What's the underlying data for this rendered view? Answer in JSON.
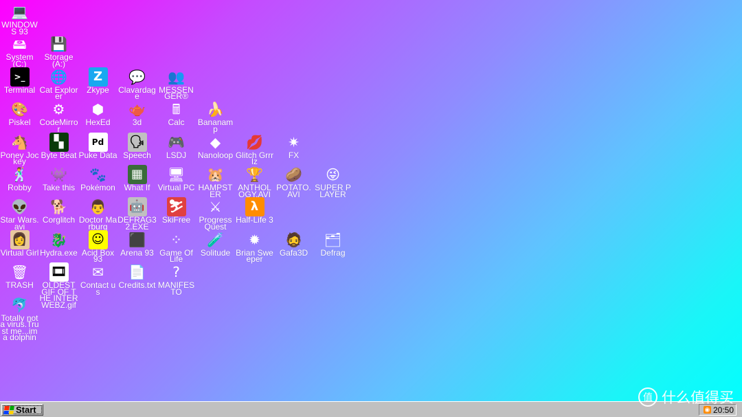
{
  "desktop": {
    "icons": [
      {
        "label": "WINDOWS 93",
        "icon": "computer-icon",
        "glyph": "💻",
        "bg": "transparent"
      },
      {
        "label": "System (C:)",
        "icon": "hard-drive-icon",
        "glyph": "🖴",
        "bg": "transparent"
      },
      {
        "label": "Storage (A:)",
        "icon": "floppy-drive-icon",
        "glyph": "💾",
        "bg": "transparent"
      },
      {
        "label": "Terminal",
        "icon": "terminal-icon",
        "glyph": ">_",
        "bg": "#000000"
      },
      {
        "label": "Cat Explorer",
        "icon": "globe-cat-icon",
        "glyph": "🌐",
        "bg": "transparent"
      },
      {
        "label": "Zkype",
        "icon": "zkype-icon",
        "glyph": "Z",
        "bg": "#18a8f0"
      },
      {
        "label": "Clavardage",
        "icon": "chat-bubble-icon",
        "glyph": "💬",
        "bg": "transparent"
      },
      {
        "label": "MESSENGER®",
        "icon": "messenger-icon",
        "glyph": "👥",
        "bg": "transparent"
      },
      {
        "label": "Piskel",
        "icon": "palette-icon",
        "glyph": "🎨",
        "bg": "transparent"
      },
      {
        "label": "CodeMirror",
        "icon": "codemirror-icon",
        "glyph": "⚙",
        "bg": "transparent"
      },
      {
        "label": "HexEd",
        "icon": "hex-cube-icon",
        "glyph": "⬢",
        "bg": "transparent"
      },
      {
        "label": "3d",
        "icon": "teapot-icon",
        "glyph": "🫖",
        "bg": "transparent"
      },
      {
        "label": "Calc",
        "icon": "calculator-icon",
        "glyph": "🖩",
        "bg": "transparent"
      },
      {
        "label": "Bananamp",
        "icon": "banana-icon",
        "glyph": "🍌",
        "bg": "transparent"
      },
      {
        "label": "Poney Jockey",
        "icon": "pony-icon",
        "glyph": "🐴",
        "bg": "transparent"
      },
      {
        "label": "Byte Beat",
        "icon": "bytebeat-icon",
        "glyph": "▚",
        "bg": "#0a3a0a"
      },
      {
        "label": "Puke Data",
        "icon": "puke-data-icon",
        "glyph": "Pd",
        "bg": "#ffffff"
      },
      {
        "label": "Speech",
        "icon": "speech-face-icon",
        "glyph": "🗣",
        "bg": "#c0c0c0"
      },
      {
        "label": "LSDJ",
        "icon": "gameboy-icon",
        "glyph": "🎮",
        "bg": "transparent"
      },
      {
        "label": "Nanoloop",
        "icon": "nanoloop-icon",
        "glyph": "◆",
        "bg": "transparent"
      },
      {
        "label": "Glitch Grrrlz",
        "icon": "lips-icon",
        "glyph": "💋",
        "bg": "transparent"
      },
      {
        "label": "FX",
        "icon": "fx-star-icon",
        "glyph": "✷",
        "bg": "transparent"
      },
      {
        "label": "Robby",
        "icon": "stick-figure-icon",
        "glyph": "🕺",
        "bg": "transparent"
      },
      {
        "label": "Take this",
        "icon": "take-this-icon",
        "glyph": "👾",
        "bg": "transparent"
      },
      {
        "label": "Pokémon",
        "icon": "pokemon-icon",
        "glyph": "🐾",
        "bg": "transparent"
      },
      {
        "label": "What If",
        "icon": "what-if-icon",
        "glyph": "▦",
        "bg": "#3a6b3a"
      },
      {
        "label": "Virtual PC",
        "icon": "virtual-pc-icon",
        "glyph": "🖥",
        "bg": "transparent"
      },
      {
        "label": "HAMPSTER",
        "icon": "hampster-icon",
        "glyph": "🐹",
        "bg": "transparent"
      },
      {
        "label": "ANTHOLOGY.AVI",
        "icon": "trophy-icon",
        "glyph": "🏆",
        "bg": "transparent"
      },
      {
        "label": "POTATO.AVI",
        "icon": "potato-icon",
        "glyph": "🥔",
        "bg": "transparent"
      },
      {
        "label": "SUPER PLAYER",
        "icon": "troll-face-icon",
        "glyph": "😜",
        "bg": "transparent"
      },
      {
        "label": "Star Wars.avi",
        "icon": "yoda-icon",
        "glyph": "👽",
        "bg": "transparent"
      },
      {
        "label": "Corglitch",
        "icon": "corgi-icon",
        "glyph": "🐕",
        "bg": "transparent"
      },
      {
        "label": "Doctor Marburg",
        "icon": "doctor-icon",
        "glyph": "👨",
        "bg": "transparent"
      },
      {
        "label": "DEFRAG32.EXE",
        "icon": "defrag32-icon",
        "glyph": "🤖",
        "bg": "#c0c0c0"
      },
      {
        "label": "SkiFree",
        "icon": "skifree-icon",
        "glyph": "⛷",
        "bg": "#e04040"
      },
      {
        "label": "Progress Quest",
        "icon": "crossed-swords-icon",
        "glyph": "⚔",
        "bg": "transparent"
      },
      {
        "label": "Half-Life 3",
        "icon": "half-life-icon",
        "glyph": "λ",
        "bg": "#ff8c00"
      },
      {
        "label": "Virtual Girl",
        "icon": "virtual-girl-icon",
        "glyph": "👩",
        "bg": "#e8c8a0"
      },
      {
        "label": "Hydra.exe",
        "icon": "hydra-icon",
        "glyph": "🐉",
        "bg": "transparent"
      },
      {
        "label": "Acid Box 93",
        "icon": "acid-smiley-icon",
        "glyph": "☺",
        "bg": "#ffff00"
      },
      {
        "label": "Arena 93",
        "icon": "arena-cube-icon",
        "glyph": "⬛",
        "bg": "transparent"
      },
      {
        "label": "Game Of Life",
        "icon": "game-of-life-icon",
        "glyph": "⁘",
        "bg": "transparent"
      },
      {
        "label": "Solitude",
        "icon": "solitude-icon",
        "glyph": "🧪",
        "bg": "transparent"
      },
      {
        "label": "Brian Sweeper",
        "icon": "mine-icon",
        "glyph": "✹",
        "bg": "transparent"
      },
      {
        "label": "Gafa3D",
        "icon": "gafa3d-icon",
        "glyph": "🧔",
        "bg": "transparent"
      },
      {
        "label": "Defrag",
        "icon": "defrag-icon",
        "glyph": "🗂",
        "bg": "transparent"
      },
      {
        "label": "TRASH",
        "icon": "trash-icon",
        "glyph": "🗑",
        "bg": "transparent"
      },
      {
        "label": "OLDEST GIF OF THE INTERWEBZ.gif",
        "icon": "gif-file-icon",
        "glyph": "🎞",
        "bg": "#ffffff"
      },
      {
        "label": "Contact us",
        "icon": "contact-icon",
        "glyph": "✉",
        "bg": "transparent"
      },
      {
        "label": "Credits.txt",
        "icon": "text-file-icon",
        "glyph": "📄",
        "bg": "transparent"
      },
      {
        "label": "MANIFESTO",
        "icon": "question-mark-icon",
        "glyph": "?",
        "bg": "transparent"
      },
      {
        "label": "Totally not a virus.Trust me...im a dolphin",
        "icon": "dolphin-icon",
        "glyph": "🐬",
        "bg": "transparent"
      }
    ]
  },
  "taskbar": {
    "start_label": "Start",
    "clock": "20:50",
    "tray_icon": "rss-icon"
  },
  "watermark": {
    "badge": "值",
    "text": "什么值得买"
  },
  "colors": {
    "gradient_start": "#ff00ff",
    "gradient_end": "#00ffff",
    "taskbar": "#c0c0c0"
  }
}
